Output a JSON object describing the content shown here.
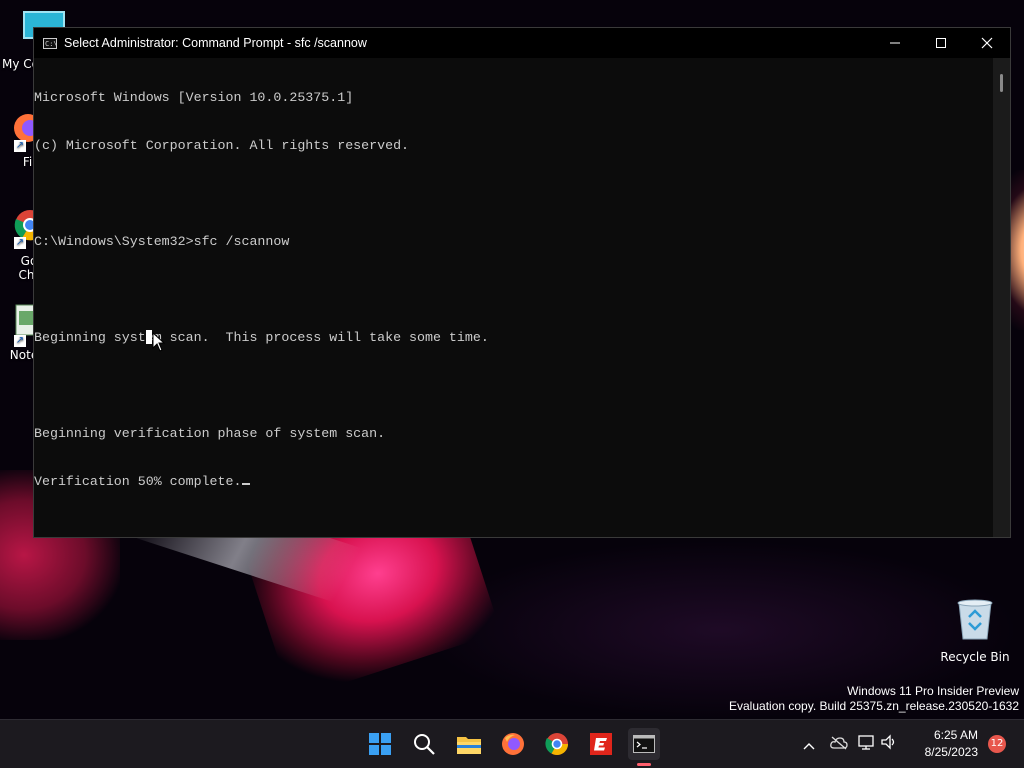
{
  "desktop": {
    "icons": [
      {
        "label": "My Co",
        "icon": "monitor-icon"
      },
      {
        "label": "Fir",
        "icon": "firefox-icon"
      },
      {
        "label": "Go\nChr",
        "icon": "chrome-icon"
      },
      {
        "label": "Note",
        "icon": "notepad-icon"
      }
    ],
    "recycle_bin": {
      "label": "Recycle Bin",
      "icon": "recycle-bin-icon"
    },
    "watermark": {
      "line1": "Windows 11 Pro Insider Preview",
      "line2": "Evaluation copy. Build 25375.zn_release.230520-1632"
    }
  },
  "window": {
    "title": "Select Administrator:  Command Prompt - sfc  /scannow",
    "console_lines": [
      "Microsoft Windows [Version 10.0.25375.1]",
      "(c) Microsoft Corporation. All rights reserved.",
      "",
      "C:\\Windows\\System32>sfc /scannow",
      "",
      "Beginning system scan.  This process will take some time.",
      "",
      "Beginning verification phase of system scan.",
      "Verification 50% complete."
    ]
  },
  "taskbar": {
    "apps": [
      {
        "name": "start",
        "icon": "windows-start-icon"
      },
      {
        "name": "search",
        "icon": "search-icon"
      },
      {
        "name": "file-explorer",
        "icon": "folder-icon"
      },
      {
        "name": "firefox",
        "icon": "firefox-icon"
      },
      {
        "name": "chrome",
        "icon": "chrome-icon"
      },
      {
        "name": "app-red",
        "icon": "red-app-icon"
      },
      {
        "name": "terminal",
        "icon": "terminal-icon"
      }
    ],
    "clock": {
      "time": "6:25 AM",
      "date": "8/25/2023"
    },
    "notification_count": "12"
  },
  "colors": {
    "console_bg": "#0c0c0c",
    "console_text": "#cccccc",
    "taskbar_bg": "#1c1a1f",
    "accent": "#ff5f6d"
  }
}
